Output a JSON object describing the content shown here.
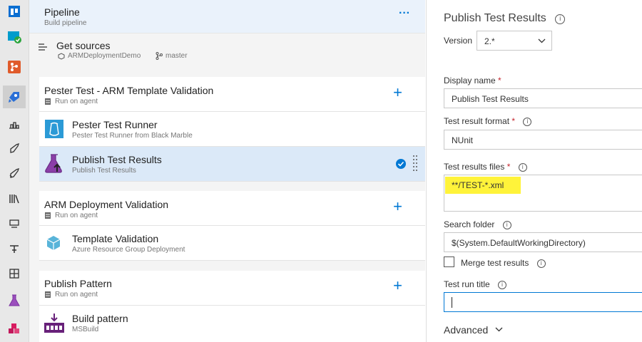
{
  "pipeline": {
    "title": "Pipeline",
    "subtitle": "Build pipeline",
    "more": "···"
  },
  "get_sources": {
    "title": "Get sources",
    "repo": "ARMDeploymentDemo",
    "branch": "master"
  },
  "jobs": [
    {
      "title": "Pester Test - ARM Template Validation",
      "subtitle": "Run on agent",
      "tasks": [
        {
          "title": "Pester Test Runner",
          "subtitle": "Pester Test Runner from Black Marble",
          "icon": "pester-icon"
        },
        {
          "title": "Publish Test Results",
          "subtitle": "Publish Test Results",
          "icon": "flask-icon",
          "selected": true
        }
      ]
    },
    {
      "title": "ARM Deployment Validation",
      "subtitle": "Run on agent",
      "tasks": [
        {
          "title": "Template Validation",
          "subtitle": "Azure Resource Group Deployment",
          "icon": "cube-icon"
        }
      ]
    },
    {
      "title": "Publish Pattern",
      "subtitle": "Run on agent",
      "tasks": [
        {
          "title": "Build pattern",
          "subtitle": "MSBuild",
          "icon": "msbuild-icon"
        }
      ]
    }
  ],
  "panel": {
    "title": "Publish Test Results",
    "version_label": "Version",
    "version_value": "2.*",
    "display_name_label": "Display name",
    "display_name_value": "Publish Test Results",
    "format_label": "Test result format",
    "format_value": "NUnit",
    "files_label": "Test results files",
    "files_value": "**/TEST-*.xml",
    "folder_label": "Search folder",
    "folder_value": "$(System.DefaultWorkingDirectory)",
    "merge_label": "Merge test results",
    "run_title_label": "Test run title",
    "run_title_value": "",
    "advanced_label": "Advanced",
    "required_mark": "*"
  },
  "colors": {
    "accent": "#0078d4",
    "highlight": "#fff33a",
    "selected_row": "#dbe9f8",
    "required": "#c4262e"
  }
}
